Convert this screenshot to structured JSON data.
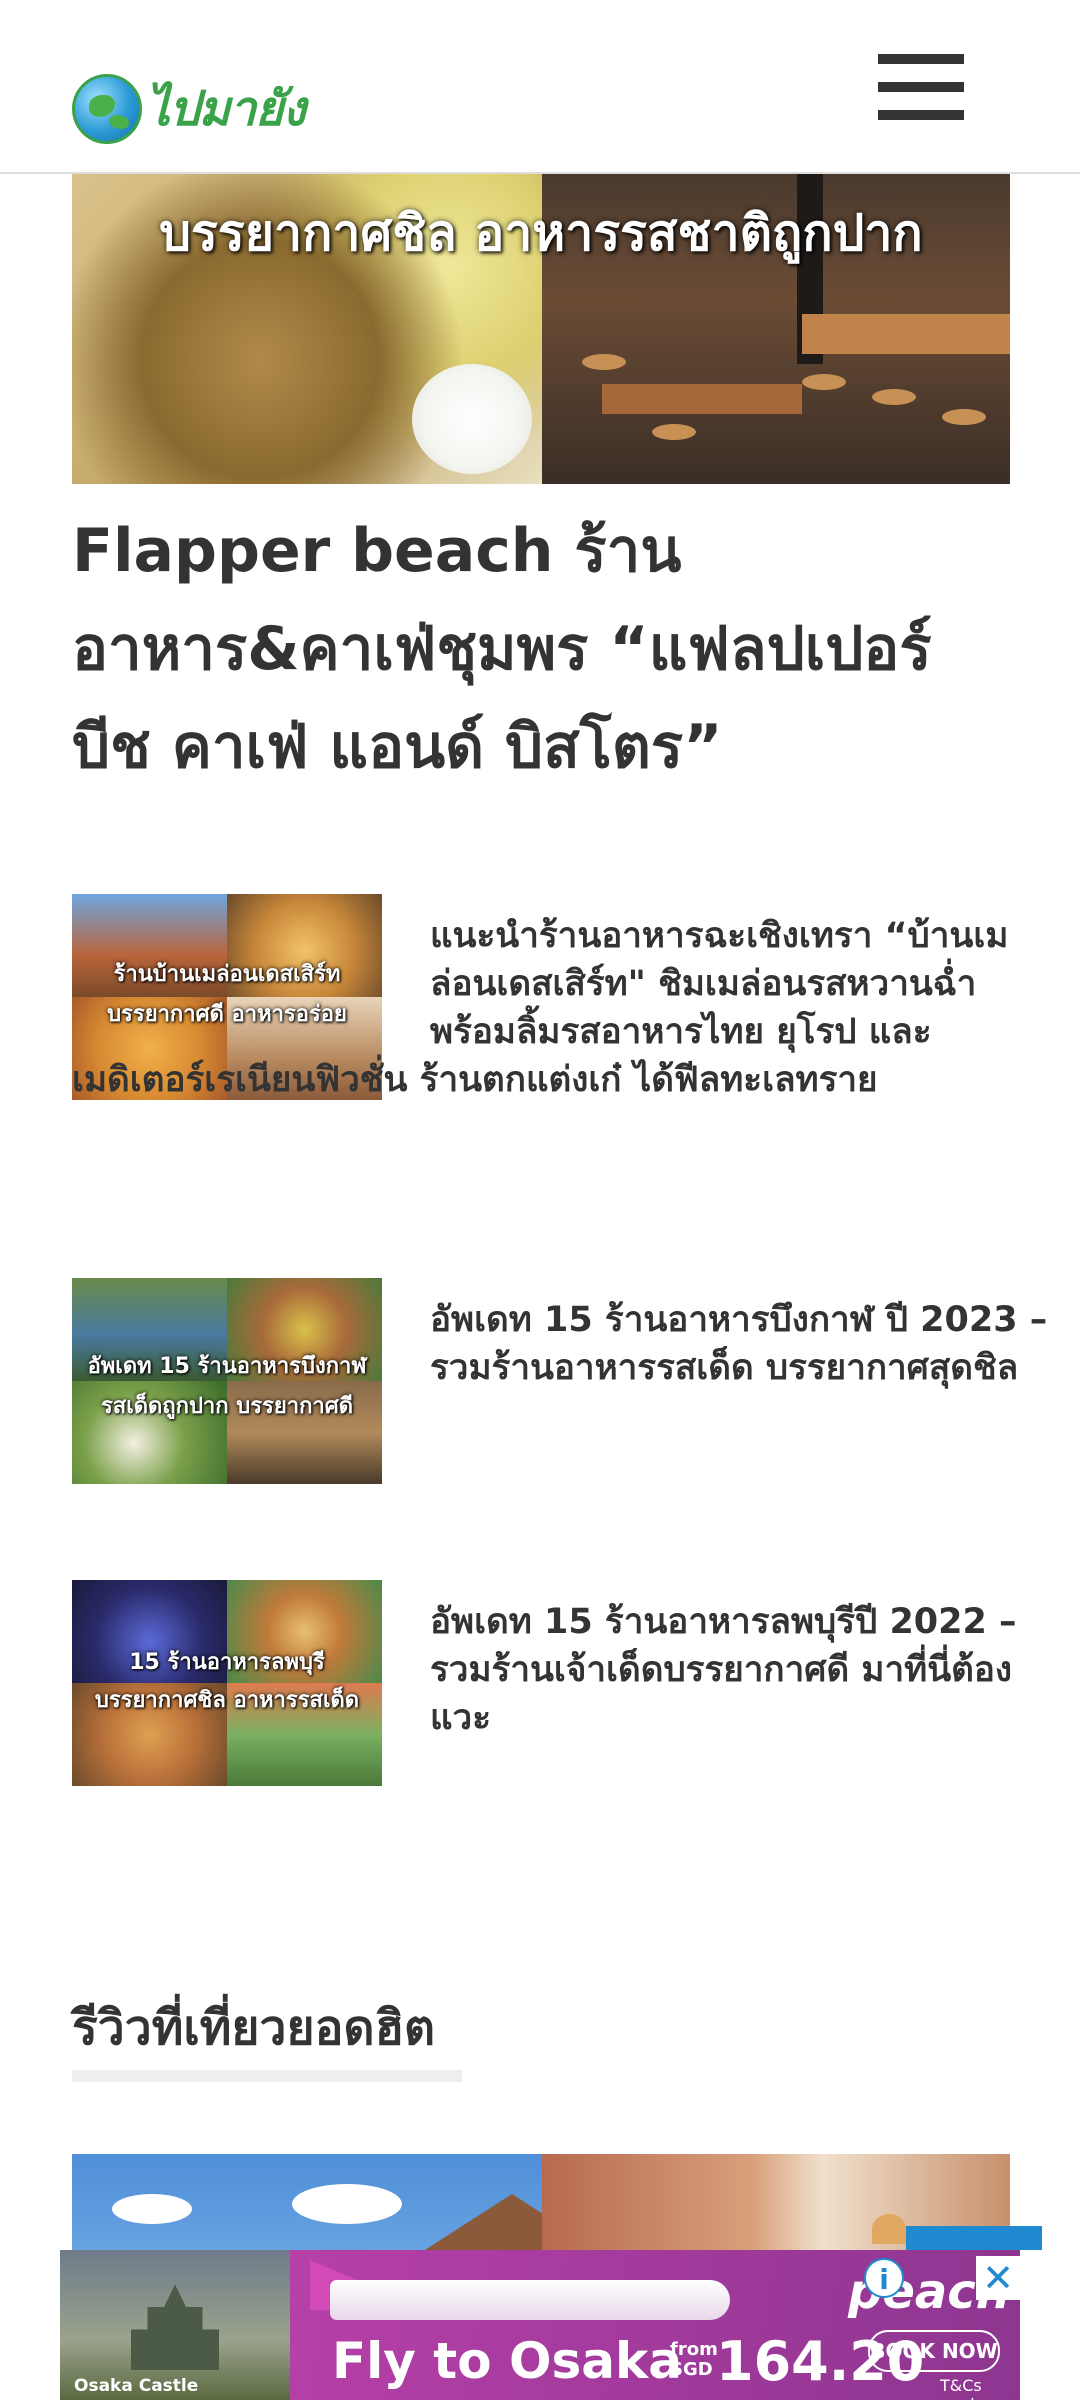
{
  "header": {
    "logo_text": "ไปมายัง",
    "logo_icon": "globe-icon",
    "menu_icon": "hamburger-menu-icon"
  },
  "hero": {
    "caption": "บรรยากาศชิล อาหารรสชาติถูกปาก"
  },
  "post": {
    "title_lines": [
      "Flapper beach ร้าน",
      "อาหาร&คาเฟ่ชุมพร “แฟลปเปอร์",
      "บีช คาเฟ่ แอนด์ บิสโตร”"
    ]
  },
  "articles": [
    {
      "thumb_caption": [
        "ร้านบ้านเมล่อนเดสเสิร์ท",
        "บรรยากาศดี อาหารอร่อย"
      ],
      "excerpt_lines": [
        "แนะนำร้านอาหารฉะเชิงเทรา “บ้านเม",
        "ล่อนเดสเสิร์ท\" ชิมเมล่อนรสหวานฉ่ำ",
        "พร้อมลิ้มรสอาหารไทย ยุโรป และ",
        "เมดิเตอร์เรเนียนฟิวชั่น ร้านตกแต่งเก๋ ได้ฟีลทะเลทราย"
      ]
    },
    {
      "thumb_caption": [
        "อัพเดท 15 ร้านอาหารบึงกาฬ",
        "รสเด็ดถูกปาก บรรยากาศดี"
      ],
      "excerpt_lines": [
        "อัพเดท 15 ร้านอาหารบึงกาฬ ปี 2023 –",
        "รวมร้านอาหารรสเด็ด บรรยากาศสุดชิล"
      ]
    },
    {
      "thumb_caption": [
        "15 ร้านอาหารลพบุรี",
        "บรรยากาศชิล อาหารรสเด็ด"
      ],
      "excerpt_lines": [
        "อัพเดท 15 ร้านอาหารลพบุรีปี 2022 –",
        "รวมร้านเจ้าเด็ดบรรยากาศดี มาที่นี่ต้อง",
        "แวะ"
      ]
    }
  ],
  "section": {
    "heading": "รีวิวที่เที่ยวยอดฮิต"
  },
  "ad": {
    "brand": "peach",
    "headline": "Fly to Osaka",
    "from_label": "from",
    "currency": "SGD",
    "price": "164.20",
    "cta": "BOOK NOW",
    "terms": "T&Cs apply.",
    "place": "Osaka Castle",
    "info_icon": "info-icon",
    "close_icon": "close-icon",
    "accent_color": "#1f8ad0"
  },
  "colors": {
    "text": "#333333",
    "logo_green": "#3aa34a",
    "ad_purple": "#a23a9c"
  }
}
